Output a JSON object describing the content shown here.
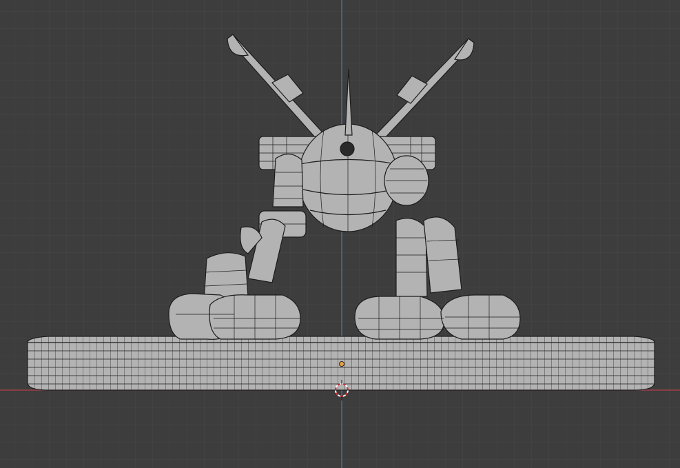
{
  "app": {
    "name": "",
    "viewport_mode": "3d-viewport-front-orthographic-wireframe"
  },
  "colors": {
    "background": "#3d3d3d",
    "grid_minor": "#474747",
    "grid_major": "#525252",
    "axis_x": "#b5404d",
    "axis_z": "#4f78b8",
    "mesh_fill": "#b3b3b3",
    "mesh_wire": "#1c1c1c",
    "origin_dot": "#e8a040",
    "cursor_red": "#d8303a",
    "cursor_white": "#ffffff"
  },
  "scene": {
    "object": "robot-figure-on-round-base",
    "icons": [
      "3d-cursor-icon",
      "object-origin-icon"
    ]
  }
}
